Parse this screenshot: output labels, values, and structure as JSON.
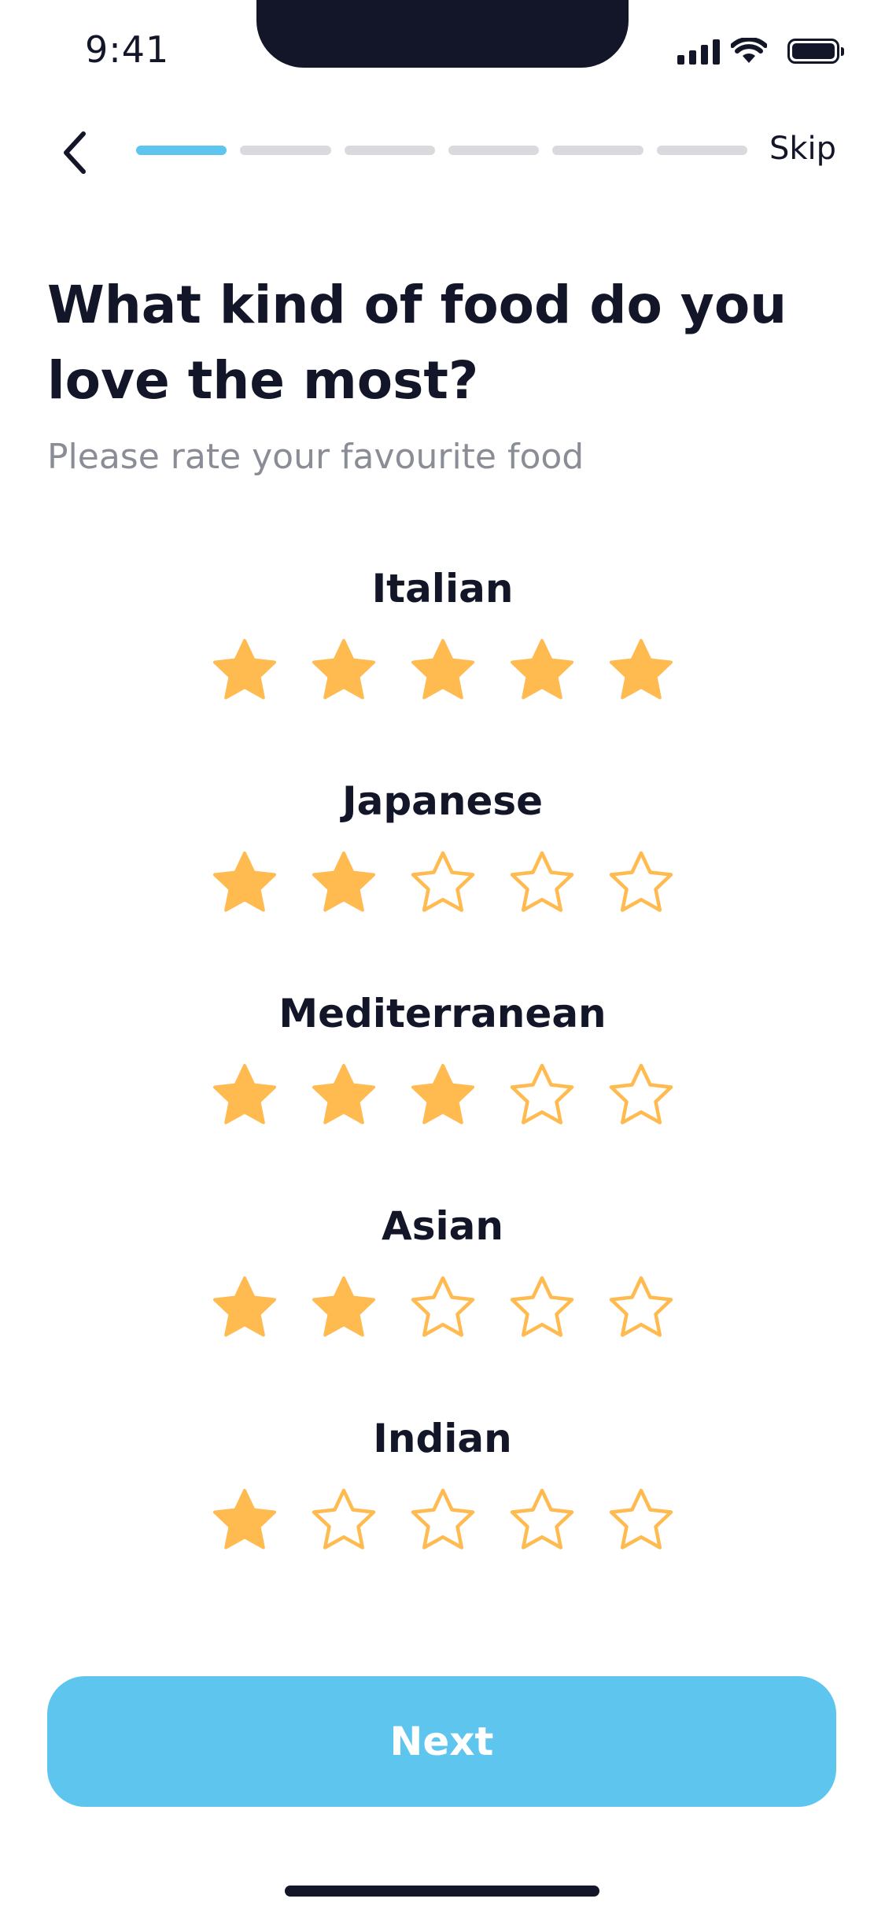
{
  "status_bar": {
    "time": "9:41"
  },
  "nav": {
    "back_icon": "chevron-left-icon",
    "progress_steps": 6,
    "progress_current": 1,
    "skip_label": "Skip"
  },
  "header": {
    "title": "What kind of food do you love the most?",
    "subtitle": "Please rate your favourite food"
  },
  "ratings": [
    {
      "label": "Italian",
      "rating": 5,
      "max": 5
    },
    {
      "label": "Japanese",
      "rating": 2,
      "max": 5
    },
    {
      "label": "Mediterranean",
      "rating": 3,
      "max": 5
    },
    {
      "label": "Asian",
      "rating": 2,
      "max": 5
    },
    {
      "label": "Indian",
      "rating": 1,
      "max": 5
    }
  ],
  "footer": {
    "next_label": "Next"
  },
  "colors": {
    "accent": "#5EC5EE",
    "star": "#FFBA50",
    "text": "#131628",
    "muted": "#8A8C96",
    "track": "#D8DADE"
  }
}
